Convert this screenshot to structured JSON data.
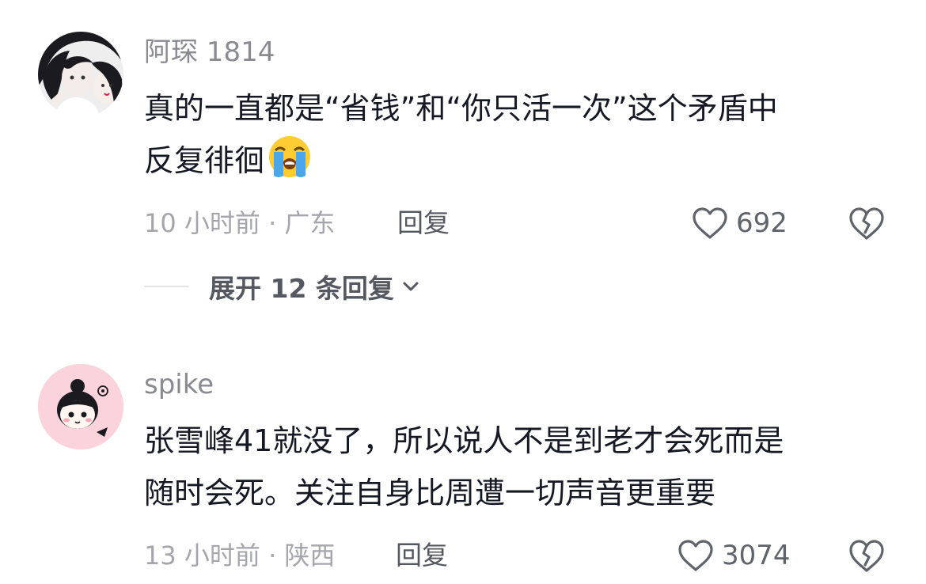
{
  "comments": [
    {
      "username": "阿琛 1814",
      "text_line1": "真的一直都是“省钱”和“你只活一次”这个矛盾中",
      "text_line2": "反复徘徊",
      "emoji_icon": "loudly-crying-face-emoji",
      "time_location": "10 小时前 · 广东",
      "reply_label": "回复",
      "like_count": "692",
      "expand_label": "展开 12 条回复"
    },
    {
      "username": "spike",
      "text_line1": "张雪峰41就没了，所以说人不是到老才会死而是",
      "text_line2": "随时会死。关注自身比周遭一切声音更重要",
      "time_location": "13 小时前 · 陕西",
      "reply_label": "回复",
      "like_count": "3074"
    }
  ],
  "icons": {
    "like": "heart-outline-icon",
    "dislike": "broken-heart-outline-icon",
    "expand": "chevron-down-icon"
  },
  "colors": {
    "text_primary": "#161823",
    "text_secondary": "#8a8b91",
    "icon_gray": "#61636b",
    "avatar2_bg": "#fbd3dc"
  }
}
